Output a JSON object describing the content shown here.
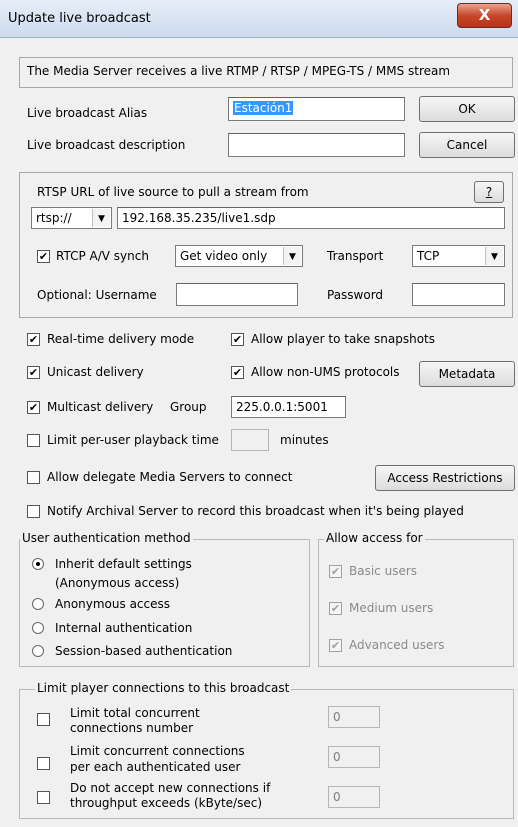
{
  "window": {
    "title": "Update live broadcast",
    "close_glyph": "X"
  },
  "banner": "The Media Server receives a live RTMP / RTSP / MPEG-TS / MMS stream",
  "alias": {
    "label": "Live broadcast Alias",
    "value": "Estación1"
  },
  "description": {
    "label": "Live broadcast description",
    "value": ""
  },
  "buttons": {
    "ok": "OK",
    "cancel": "Cancel",
    "help": "?",
    "metadata": "Metadata",
    "access": "Access Restrictions"
  },
  "rtsp": {
    "heading": "RTSP URL of live source to pull a stream from",
    "scheme": "rtsp://",
    "url": "192.168.35.235/live1.sdp",
    "rtcp_label": "RTCP A/V synch",
    "rtcp_checked": true,
    "video_option": "Get video only",
    "transport_label": "Transport",
    "transport_value": "TCP",
    "optional_label": "Optional:  Username",
    "username": "",
    "password_label": "Password",
    "password": ""
  },
  "options": {
    "realtime": "Real-time delivery mode",
    "snapshots": "Allow player to take snapshots",
    "unicast": "Unicast delivery",
    "non_ums": "Allow non-UMS protocols",
    "multicast": "Multicast delivery",
    "group_label": "Group",
    "group_value": "225.0.0.1:5001",
    "limit_time": "Limit per-user playback time",
    "minutes_label": "minutes",
    "minutes_value": "",
    "delegate": "Allow delegate Media Servers to connect",
    "notify": "Notify Archival Server to record this broadcast when it's being played"
  },
  "auth": {
    "legend": "User authentication method",
    "inherit": "Inherit default settings",
    "inherit_sub": "(Anonymous access)",
    "anonymous": "Anonymous access",
    "internal": "Internal authentication",
    "session": "Session-based authentication"
  },
  "access": {
    "legend": "Allow access for",
    "basic": "Basic users",
    "medium": "Medium users",
    "advanced": "Advanced users"
  },
  "limits": {
    "legend": "Limit player connections to this broadcast",
    "total_l1": "Limit total concurrent",
    "total_l2": "connections number",
    "total_val": "0",
    "per_l1": "Limit concurrent connections",
    "per_l2": "per each authenticated user",
    "per_val": "0",
    "thr_l1": "Do not accept new connections if",
    "thr_l2": "throughput exceeds (kByte/sec)",
    "thr_val": "0"
  },
  "glyphs": {
    "check": "✔",
    "arrow": "▼"
  }
}
